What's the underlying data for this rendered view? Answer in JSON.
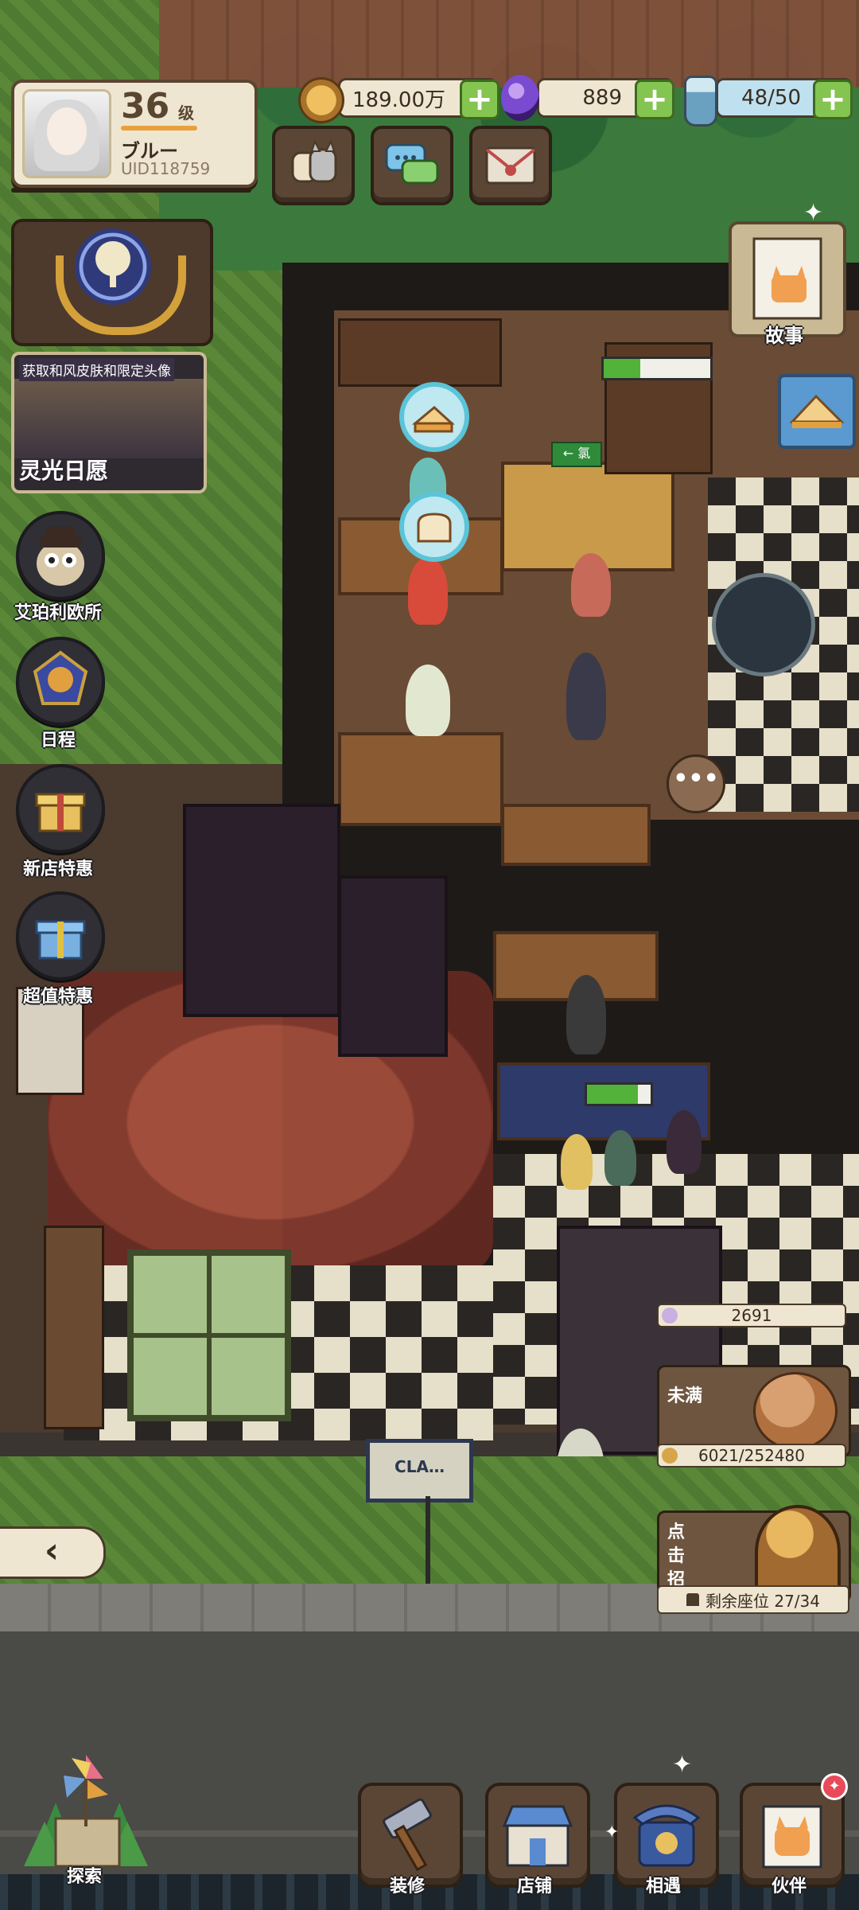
{
  "profile": {
    "level": "36",
    "level_unit": "级",
    "name": "ブルー",
    "uid": "UID118759"
  },
  "currencies": [
    {
      "name": "coins",
      "value": "189.00万",
      "icon": "coin-icon",
      "color": "#d7a64a"
    },
    {
      "name": "gems",
      "value": "889",
      "icon": "purple-egg-gem-icon",
      "color": "#7a4ad0"
    },
    {
      "name": "energy",
      "value": "48/50",
      "icon": "potion-bottle-icon",
      "color": "#9fd0e8"
    }
  ],
  "top_buttons": [
    {
      "icon": "cats-icon"
    },
    {
      "icon": "chat-bubbles-icon"
    },
    {
      "icon": "mail-envelope-icon"
    }
  ],
  "event": {
    "title": "获取和风皮肤和限定头像",
    "name": "灵光日愿"
  },
  "side_menu": [
    {
      "label": "艾珀利欧所",
      "icon": "owl-detective-icon"
    },
    {
      "label": "日程",
      "icon": "schedule-badge-icon"
    },
    {
      "label": "新店特惠",
      "icon": "gift-box-gold-icon"
    },
    {
      "label": "超值特惠",
      "icon": "gift-box-blue-icon"
    }
  ],
  "story": {
    "label": "故事",
    "icon": "cat-book-icon"
  },
  "customer_counter": {
    "unfilled_label": "未满",
    "top_value": "2691",
    "progress_text": "6021/252480"
  },
  "recruit": {
    "label": "点击招募",
    "seats_text": "剩余座位 27/34"
  },
  "bottom_nav": [
    {
      "label": "探索",
      "icon": "pinwheel-map-icon"
    },
    {
      "label": "装修",
      "icon": "hammer-icon"
    },
    {
      "label": "店铺",
      "icon": "storefront-icon"
    },
    {
      "label": "相遇",
      "icon": "telephone-icon"
    },
    {
      "label": "伙伴",
      "icon": "cat-portrait-icon"
    }
  ],
  "exit_sign": "← 氯",
  "board_sign": "CLA…",
  "collapse_label": "‹",
  "more_bubble": "•••",
  "colors": {
    "panel_bg": "#efe6d2",
    "panel_border": "#4a3a28",
    "plus_green": "#84c450",
    "progress_green": "#52b23a",
    "notification_red": "#e84a5a"
  }
}
